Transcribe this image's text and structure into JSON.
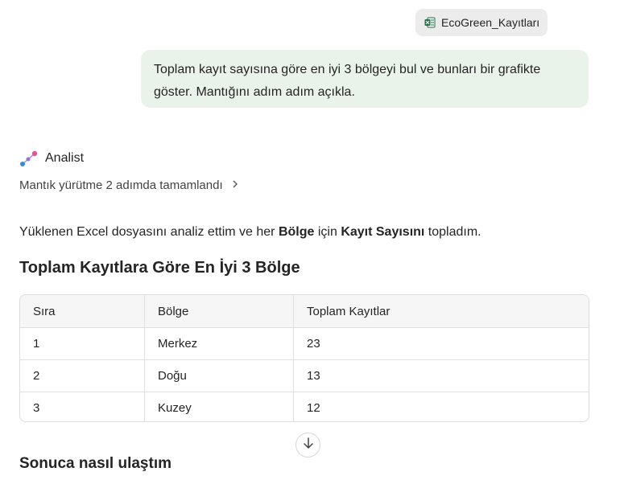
{
  "attachment": {
    "file_name": "EcoGreen_Kayıtları",
    "icon": "excel-file-icon"
  },
  "user_message": {
    "text": "Toplam kayıt sayısına göre en iyi 3 bölgeyi bul ve bunları bir grafikte göster. Mantığını adım adım açıkla."
  },
  "agent": {
    "name": "Analist",
    "icon": "analyst-icon",
    "reasoning_label": "Mantık yürütme 2 adımda tamamlandı"
  },
  "response": {
    "intro_part1": "Yüklenen Excel dosyasını analiz ettim ve her ",
    "intro_bold1": "Bölge",
    "intro_part2": " için ",
    "intro_bold2": "Kayıt Sayısını",
    "intro_part3": " topladım.",
    "table_title": "Toplam Kayıtlara Göre En İyi 3 Bölge",
    "table": {
      "headers": [
        "Sıra",
        "Bölge",
        "Toplam Kayıtlar"
      ],
      "rows": [
        [
          "1",
          "Merkez",
          "23"
        ],
        [
          "2",
          "Doğu",
          "13"
        ],
        [
          "3",
          "Kuzey",
          "12"
        ]
      ]
    },
    "next_section_title": "Sonuca nasıl ulaştım"
  },
  "colors": {
    "user_bubble": "#eaf3ea",
    "file_chip": "#ececec",
    "excel_green": "#1e7145"
  }
}
